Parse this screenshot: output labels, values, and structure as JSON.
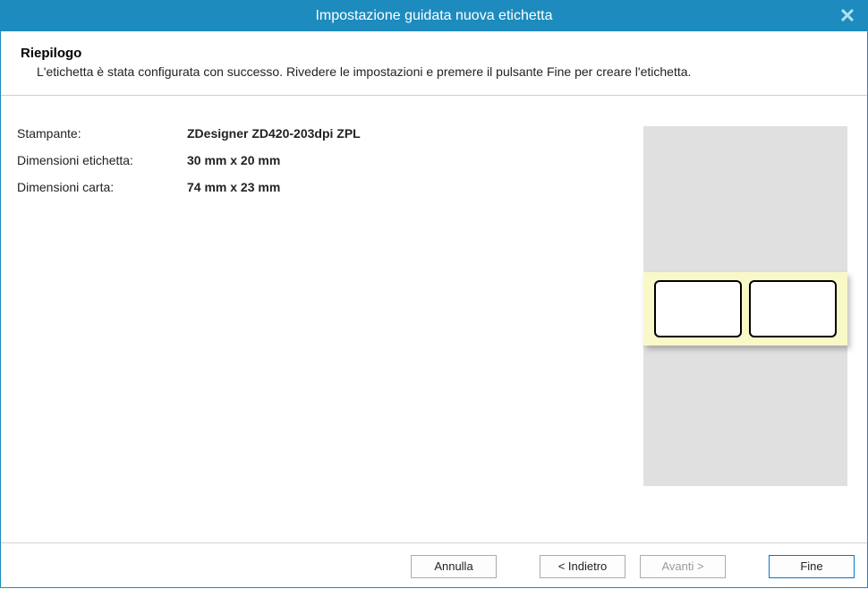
{
  "window": {
    "title": "Impostazione guidata nuova etichetta"
  },
  "header": {
    "title": "Riepilogo",
    "description": "L'etichetta è stata configurata con successo. Rivedere le impostazioni e premere il pulsante Fine per creare l'etichetta."
  },
  "summary": {
    "rows": [
      {
        "label": "Stampante:",
        "value": "ZDesigner ZD420-203dpi ZPL"
      },
      {
        "label": "Dimensioni etichetta:",
        "value": "30 mm x 20 mm"
      },
      {
        "label": "Dimensioni carta:",
        "value": "74 mm x 23 mm"
      }
    ]
  },
  "buttons": {
    "cancel": "Annulla",
    "back": "< Indietro",
    "next": "Avanti >",
    "finish": "Fine"
  }
}
